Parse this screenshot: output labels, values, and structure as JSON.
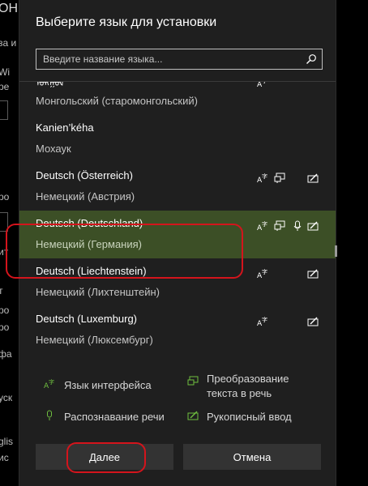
{
  "background": {
    "title": "ОН",
    "fragments": [
      "за и д",
      "Wi",
      "ре",
      "ро",
      "ит",
      "т",
      "ита",
      "ро",
      "ро",
      "фа",
      "уск",
      "glis",
      "ис"
    ]
  },
  "dialog": {
    "title": "Выберите язык для установки",
    "search_placeholder": "Введите название языка..."
  },
  "languages": [
    {
      "primary": "ᠮᠣᠩᠭᠣᠯ",
      "secondary": "Монгольский (старомонгольский)"
    },
    {
      "primary": "Kanien’kéha",
      "secondary": "Мохаук"
    },
    {
      "primary": "Deutsch (Österreich)",
      "secondary": "Немецкий (Австрия)"
    },
    {
      "primary": "Deutsch (Deutschland)",
      "secondary": "Немецкий (Германия)"
    },
    {
      "primary": "Deutsch (Liechtenstein)",
      "secondary": "Немецкий (Лихтенштейн)"
    },
    {
      "primary": "Deutsch (Luxemburg)",
      "secondary": "Немецкий (Люксембург)"
    }
  ],
  "legend": {
    "interface": "Язык интерфейса",
    "tts_line1": "Преобразование",
    "tts_line2": "текста в речь",
    "speech": "Распознавание речи",
    "handwriting": "Рукописный ввод"
  },
  "buttons": {
    "next": "Далее",
    "cancel": "Отмена"
  },
  "colors": {
    "selected_row": "#3c4f26",
    "accent_green": "#6fbf3f",
    "annotation_red": "#d4141c"
  }
}
